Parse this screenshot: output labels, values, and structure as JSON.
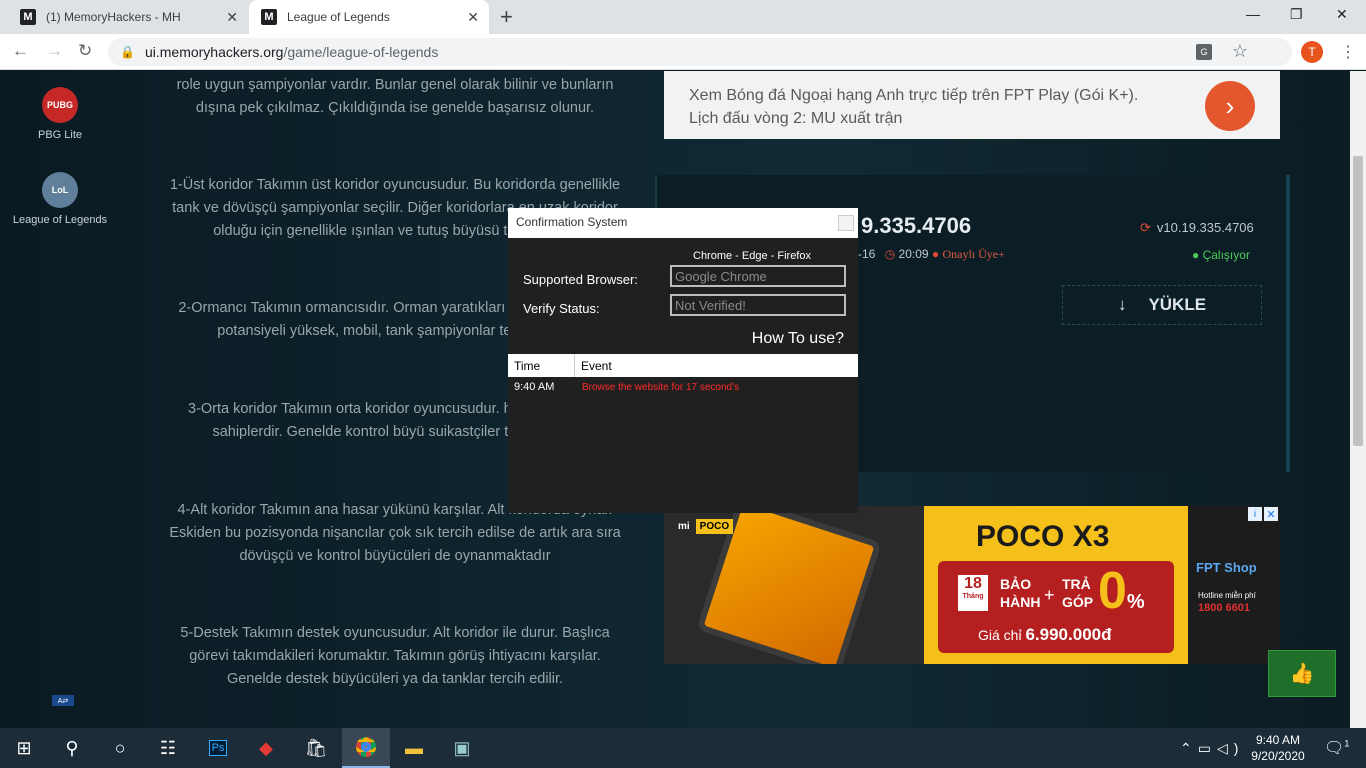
{
  "browser": {
    "tabs": [
      {
        "favicon": "M",
        "title": "(1) MemoryHackers - MH"
      },
      {
        "favicon": "M",
        "title": "League of Legends"
      }
    ],
    "new_tab": "+",
    "url_host": "ui.memoryhackers.org",
    "url_path": "/game/league-of-legends",
    "profile_initial": "T",
    "window_controls": {
      "minimize": "—",
      "maximize": "❐",
      "close": "✕"
    }
  },
  "sidebar": {
    "items": [
      {
        "icon": "PUBG",
        "label": "PBG Lite",
        "color": "#c62828"
      },
      {
        "icon": "LoL",
        "label": "League of Legends",
        "color": "#5f7f9a"
      }
    ],
    "lang_button": "A⇄"
  },
  "article": {
    "paragraphs": [
      "role uygun şampiyonlar vardır. Bunlar genel olarak bilinir ve bunların dışına pek çıkılmaz. Çıkıldığında ise genelde başarısız olunur.",
      "1-Üst koridor Takımın üst koridor oyuncusudur. Bu koridorda genellikle tank ve dövüşçü şampiyonlar seçilir. Diğer koridorlara en uzak koridor olduğu için genellikle ışınlan ve tutuş büyüsü tercih edilir.",
      "2-Ormancı Takımın ormancısıdır. Orman yaratıkları güçlenir. Baskın potansiyeli yüksek, mobil, tank şampiyonlar tercih edilir.",
      "3-Orta koridor Takımın orta koridor oyuncusudur. hasar yüklerine sahiplerdir. Genelde kontrol büyü suikastçiler tercih edilir.",
      "4-Alt koridor Takımın ana hasar yükünü karşılar. Alt koridorda oynar. Eskiden bu pozisyonda nişancılar çok sık tercih edilse de artık ara sıra dövüşçü ve kontrol büyücüleri de oynanmaktadır",
      "5-Destek Takımın destek oyuncusudur. Alt koridor ile durur. Başlıca görevi takımdakileri korumaktır. Takımın görüş ihtiyacını karşılar. Genelde destek büyücüleri ya da tanklar tercih edilir."
    ]
  },
  "ad_top": {
    "line1": "Xem Bóng đá Ngoại hạng Anh trực tiếp trên FPT Play (Gói K+).",
    "line2": "Lịch đấu vòng 2: MU xuất trận",
    "arrow": "›"
  },
  "download_panel": {
    "version_big": "9.335.4706",
    "date_suffix": "-16",
    "time": "20:09",
    "approved": "Onaylı Üye+",
    "version": "v10.19.335.4706",
    "status": "Çalışıyor",
    "download_label": "YÜKLE"
  },
  "ad_bottom": {
    "brand": "mi",
    "brand_tag": "POCO",
    "title": "POCO X3",
    "badge_num": "18",
    "badge_unit": "Tháng",
    "warranty_1": "BẢO",
    "warranty_2": "HÀNH",
    "plus": "+",
    "installment_1": "TRẢ",
    "installment_2": "GÓP",
    "zero": "0",
    "percent": "%",
    "price_label": "Giá chỉ",
    "price": "6.990.000đ",
    "shop_logo": "FPT Shop",
    "hotline_label": "Hotline miễn phí",
    "hotline": "1800 6601",
    "info": "i",
    "close": "✕"
  },
  "dialog": {
    "title": "Confirmation System",
    "browsers": "Chrome - Edge - Firefox",
    "supported_label": "Supported Browser:",
    "supported_value": "Google Chrome",
    "verify_label": "Verify Status:",
    "verify_value": "Not Verified!",
    "how_to": "How To use?",
    "columns": [
      "Time",
      "Event"
    ],
    "rows": [
      {
        "time": "9:40 AM",
        "event": "Browse the website for 17 second's"
      }
    ]
  },
  "like_button": "👍",
  "taskbar": {
    "time": "9:40 AM",
    "date": "9/20/2020",
    "notifications": "1"
  }
}
